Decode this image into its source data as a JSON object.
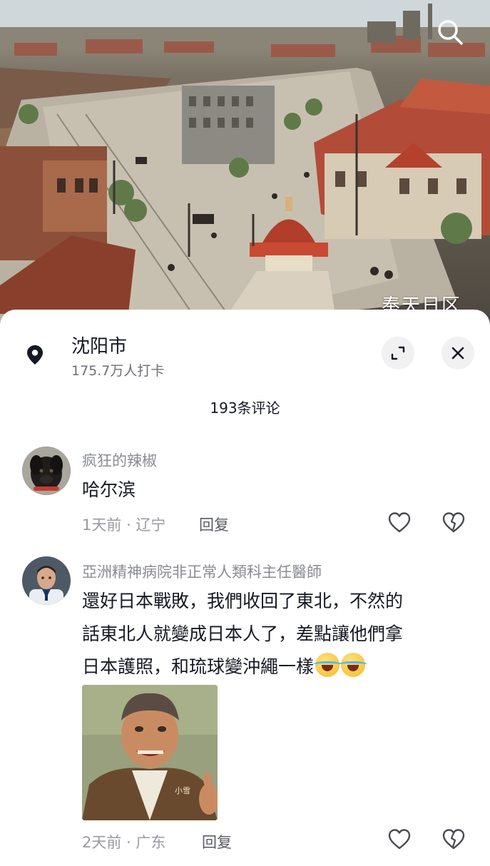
{
  "hero": {
    "caption": "奉天日区",
    "search_icon": "search-icon"
  },
  "location": {
    "icon": "location-pin-icon",
    "name": "沈阳市",
    "checkins": "175.7万人打卡",
    "expand_icon": "expand-icon",
    "close_icon": "close-icon"
  },
  "comment_count": "193条评论",
  "comments": [
    {
      "username": "疯狂的辣椒",
      "text": "哈尔滨",
      "time_location": "1天前 · 辽宁",
      "reply_label": "回复",
      "like_icon": "heart-icon",
      "dislike_icon": "broken-heart-icon"
    },
    {
      "username": "亞洲精神病院非正常人類科主任醫師",
      "text_lines": [
        "還好日本戰敗，我們收回了東北，不然的",
        "話東北人就變成日本人了，差點讓他們拿",
        "日本護照，和琉球變沖繩一樣"
      ],
      "emoji": "laughing-tears-emoji",
      "image_label": "小雪",
      "time_location": "2天前 · 广东",
      "reply_label": "回复",
      "like_icon": "heart-icon",
      "dislike_icon": "broken-heart-icon"
    }
  ],
  "colors": {
    "text_primary": "#161823",
    "text_secondary": "#8a8b91",
    "button_bg": "#f1f1f2"
  }
}
